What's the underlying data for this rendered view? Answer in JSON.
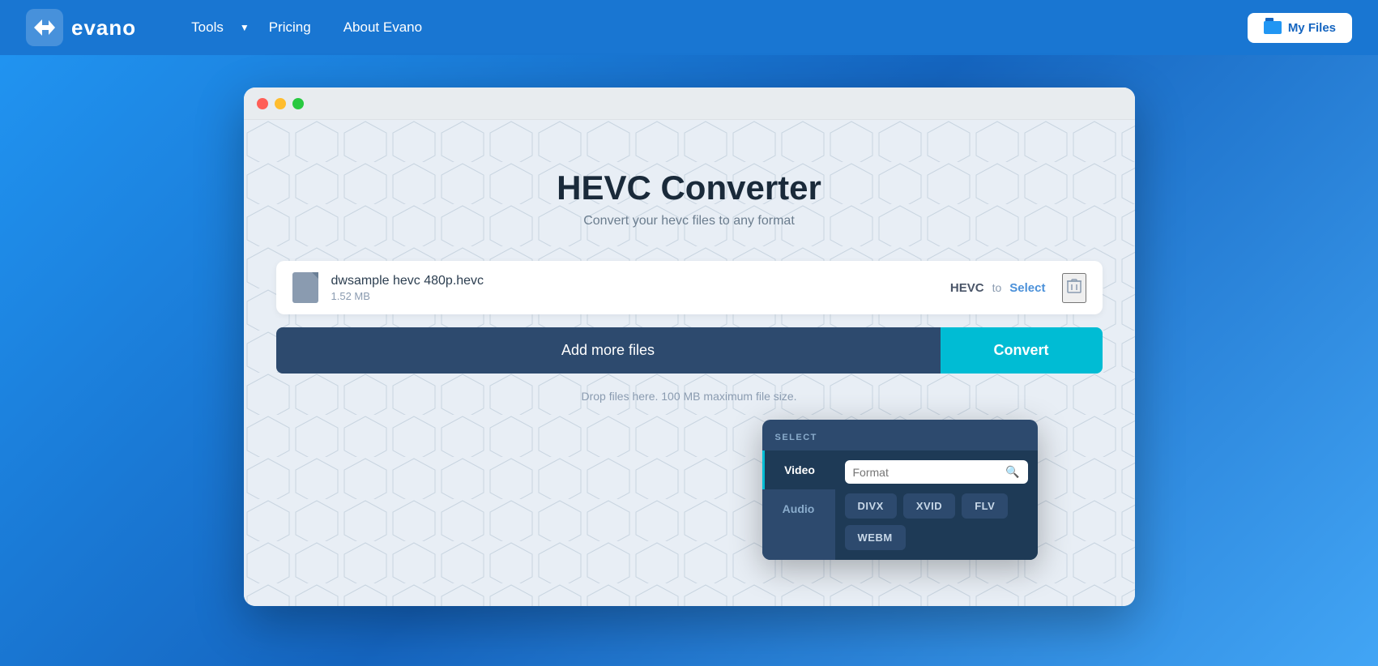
{
  "navbar": {
    "logo_text": "evano",
    "nav_tools_label": "Tools",
    "nav_pricing_label": "Pricing",
    "nav_about_label": "About Evano",
    "my_files_label": "My Files"
  },
  "window": {
    "title": "HEVC Converter",
    "subtitle": "Convert your hevc files to any format",
    "file": {
      "name": "dwsample hevc 480p.hevc",
      "size": "1.52 MB",
      "from_format": "HEVC",
      "to_label": "to",
      "select_label": "Select"
    },
    "add_files_label": "Add more files",
    "drop_text": "Drop files here. 100 MB maximum file size.",
    "dropdown": {
      "header": "SELECT",
      "search_placeholder": "Format",
      "categories": [
        {
          "label": "Video",
          "active": true
        },
        {
          "label": "Audio",
          "active": false
        }
      ],
      "formats": [
        "DIVX",
        "XVID",
        "FLV",
        "WEBM"
      ]
    }
  }
}
